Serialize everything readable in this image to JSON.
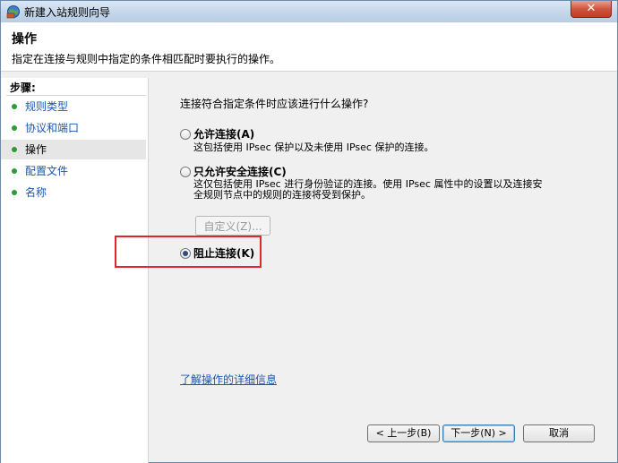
{
  "window": {
    "title": "新建入站规则向导"
  },
  "header": {
    "title": "操作",
    "description": "指定在连接与规则中指定的条件相匹配时要执行的操作。"
  },
  "sidebar": {
    "title": "步骤:",
    "items": [
      {
        "label": "规则类型",
        "active": false
      },
      {
        "label": "协议和端口",
        "active": false
      },
      {
        "label": "操作",
        "active": true
      },
      {
        "label": "配置文件",
        "active": false
      },
      {
        "label": "名称",
        "active": false
      }
    ]
  },
  "main": {
    "question": "连接符合指定条件时应该进行什么操作?",
    "options": [
      {
        "label": "允许连接(A)",
        "desc1": "这包括使用 IPsec 保护以及未使用 IPsec 保护的连接。",
        "desc2": "",
        "checked": false
      },
      {
        "label": "只允许安全连接(C)",
        "desc1": "这仅包括使用 IPsec 进行身份验证的连接。使用 IPsec 属性中的设置以及连接安",
        "desc2": "全规则节点中的规则的连接将受到保护。",
        "checked": false
      },
      {
        "label": "阻止连接(K)",
        "desc1": "",
        "desc2": "",
        "checked": true
      }
    ],
    "custom_button": "自定义(Z)...",
    "learn_more": "了解操作的详细信息"
  },
  "footer": {
    "back": "< 上一步(B)",
    "next": "下一步(N) >",
    "cancel": "取消"
  },
  "colors": {
    "link": "#1b57b1",
    "highlight": "#e0262a",
    "step_dot": "#2e9a3a"
  }
}
